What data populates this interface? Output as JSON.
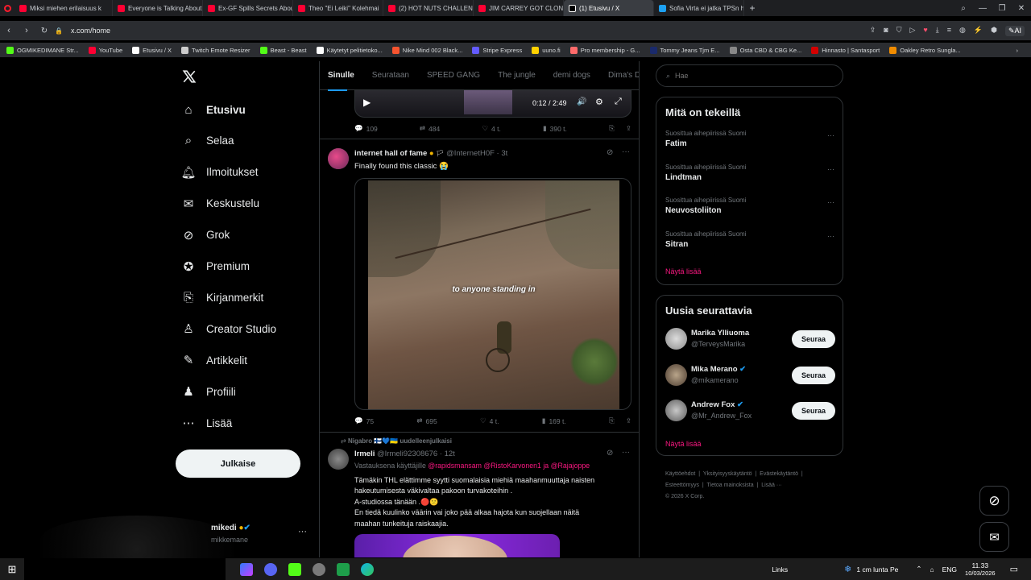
{
  "browser": {
    "tabs": [
      {
        "label": "Miksi miehen erilaisuus k",
        "color": "#ff0033"
      },
      {
        "label": "Everyone is Talking About",
        "color": "#ff0033"
      },
      {
        "label": "Ex-GF Spills Secrets About",
        "color": "#ff0033"
      },
      {
        "label": "Theo \"Ei Leiki\" Kolehmai",
        "color": "#ff0033"
      },
      {
        "label": "(2) HOT NUTS CHALLENG",
        "color": "#ff0033"
      },
      {
        "label": "JIM CARREY GOT CLONED",
        "color": "#ff0033"
      },
      {
        "label": "(1) Etusivu / X",
        "color": "#ffffff"
      },
      {
        "label": "Sofia Virta ei jatka TPSn h",
        "color": "#1da1f2"
      }
    ],
    "url": "x.com/home",
    "ai_label": "AI",
    "bookmarks": [
      {
        "label": "OGMIKEDIMANE Str...",
        "color": "#53fc18"
      },
      {
        "label": "YouTube",
        "color": "#ff0033"
      },
      {
        "label": "Etusivu / X",
        "color": "#ffffff"
      },
      {
        "label": "Twitch Emote Resizer",
        "color": "#cccccc"
      },
      {
        "label": "Beast - Beast",
        "color": "#53fc18"
      },
      {
        "label": "Käytetyt pelitietoko...",
        "color": "#ffffff"
      },
      {
        "label": "Nike Mind 002 Black...",
        "color": "#f6542f"
      },
      {
        "label": "Stripe Express",
        "color": "#635bff"
      },
      {
        "label": "uuno.fi",
        "color": "#ffd100"
      },
      {
        "label": "Pro membership - G...",
        "color": "#ff6b6b"
      },
      {
        "label": "Tommy Jeans Tjm E...",
        "color": "#1a2a6c"
      },
      {
        "label": "Osta CBD & CBG Ke...",
        "color": "#888888"
      },
      {
        "label": "Hinnasto | Santasport",
        "color": "#d40000"
      },
      {
        "label": "Oakley Retro Sungla...",
        "color": "#f08c00"
      }
    ]
  },
  "nav": {
    "items": [
      {
        "label": "Etusivu",
        "icon": "home-icon"
      },
      {
        "label": "Selaa",
        "icon": "search-icon"
      },
      {
        "label": "Ilmoitukset",
        "icon": "bell-icon"
      },
      {
        "label": "Keskustelu",
        "icon": "mail-icon"
      },
      {
        "label": "Grok",
        "icon": "grok-icon"
      },
      {
        "label": "Premium",
        "icon": "verified-icon"
      },
      {
        "label": "Kirjanmerkit",
        "icon": "bookmark-icon"
      },
      {
        "label": "Creator Studio",
        "icon": "creator-icon"
      },
      {
        "label": "Artikkelit",
        "icon": "article-icon"
      },
      {
        "label": "Profiili",
        "icon": "person-icon"
      },
      {
        "label": "Lisää",
        "icon": "more-circle-icon"
      }
    ],
    "post_label": "Julkaise",
    "account_name": "mikedi",
    "account_handle": "mikkemane",
    "more": "···"
  },
  "feed": {
    "tabs": [
      "Sinulle",
      "Seurataan",
      "SPEED GANG",
      "The jungle",
      "demi dogs",
      "Dima's Dist"
    ],
    "video1": {
      "time": "0:12 / 2:49"
    },
    "post0_actions": {
      "replies": "109",
      "reposts": "484",
      "likes": "4 t.",
      "views": "390 t."
    },
    "post1": {
      "name": "internet hall of fame",
      "handle": "@InternetH0F",
      "time": "3t",
      "text": "Finally found this classic 😭",
      "video_caption": "to anyone standing in",
      "replies": "75",
      "reposts": "695",
      "likes": "4 t.",
      "views": "169 t."
    },
    "post2": {
      "repost_by": "Nigabro 🇫🇮💙🇺🇦 uudelleenjulkaisi",
      "name": "Irmeli",
      "handle": "@Irmeli92308676",
      "time": "12t",
      "reply_prefix": "Vastauksena käyttäjille",
      "reply_to": "@rapidsmansam @RistoKarvonen1 ja @Rajajoppe",
      "line1": "Tämäkin THL elättimme syytti suomalaisia miehiä maahanmuuttaja naisten",
      "line2": "hakeutumisesta väkivaltaa pakoon turvakoteihin .",
      "line3": "A-studiossa tänään .🔴😕",
      "line4": "En tiedä kuulinko väärin vai joko pää alkaa hajota kun suojellaan näitä",
      "line5": "maahan tunkeituja raiskaajia."
    }
  },
  "right": {
    "search_placeholder": "Hae",
    "trends_title": "Mitä on tekeillä",
    "trends": [
      {
        "context": "Suosittua aihepiirissä Suomi",
        "name": "Fatim"
      },
      {
        "context": "Suosittua aihepiirissä Suomi",
        "name": "Lindtman"
      },
      {
        "context": "Suosittua aihepiirissä Suomi",
        "name": "Neuvostoliiton"
      },
      {
        "context": "Suosittua aihepiirissä Suomi",
        "name": "Sitran"
      }
    ],
    "show_more": "Näytä lisää",
    "follow_title": "Uusia seurattavia",
    "follow": [
      {
        "name": "Marika Ylliuoma",
        "handle": "@TerveysMarika",
        "verified": false
      },
      {
        "name": "Mika Merano",
        "handle": "@mikamerano",
        "verified": true
      },
      {
        "name": "Andrew Fox",
        "handle": "@Mr_Andrew_Fox",
        "verified": true
      }
    ],
    "follow_label": "Seuraa",
    "footer": [
      "Käyttöehdot",
      "Yksityisyyskäytäntö",
      "Evästekäytäntö",
      "Esteettömyys",
      "Tietoa mainoksista",
      "Lisää ···",
      "© 2026 X Corp."
    ]
  },
  "taskbar": {
    "links": "Links",
    "weather": "1 cm lunta Pe",
    "lang": "ENG",
    "time": "11.33",
    "date": "10/03/2026"
  },
  "colors": {
    "accent": "#f91880",
    "verified": "#1d9bf0",
    "bg": "#000000",
    "border": "#2f3336"
  }
}
